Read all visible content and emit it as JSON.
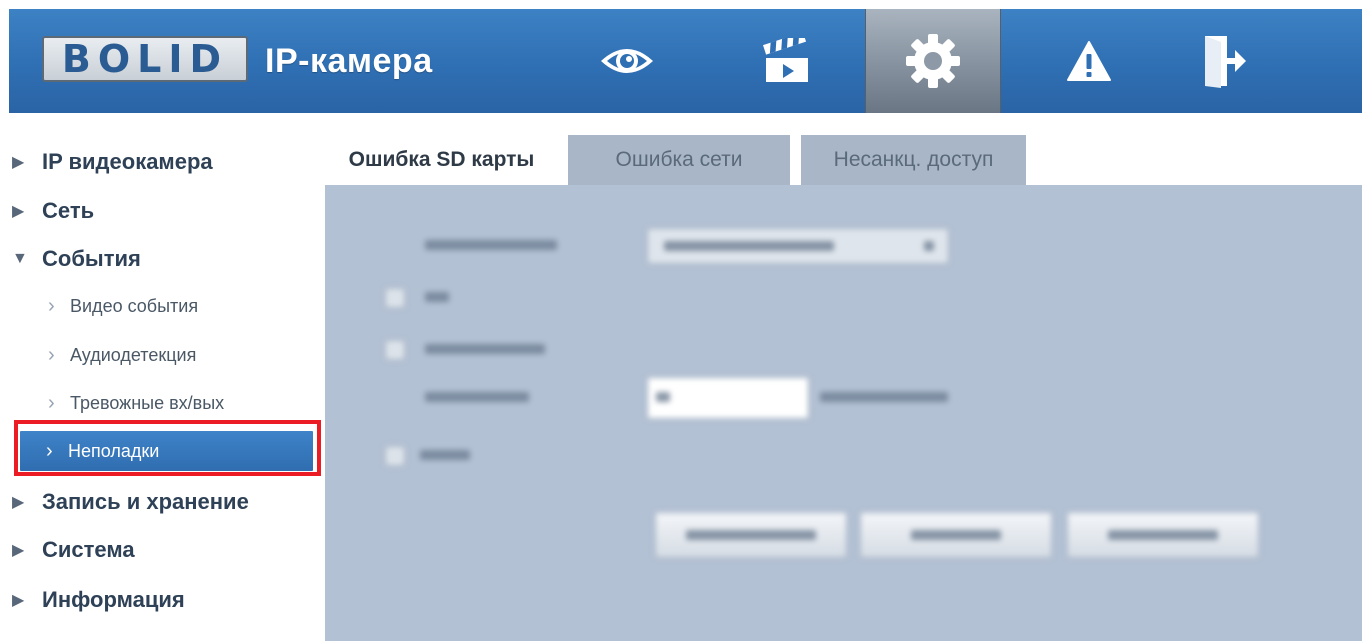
{
  "header": {
    "logo_text": "BOLID",
    "app_title": "IP-камера",
    "nav": [
      {
        "name": "live-view",
        "icon": "eye-icon",
        "active": false
      },
      {
        "name": "playback",
        "icon": "clapperboard-icon",
        "active": false
      },
      {
        "name": "settings",
        "icon": "gear-icon",
        "active": true
      },
      {
        "name": "alarm",
        "icon": "warning-triangle-icon",
        "active": false
      },
      {
        "name": "logout",
        "icon": "logout-door-icon",
        "active": false
      }
    ]
  },
  "sidebar": {
    "items": [
      {
        "label": "IP видеокамера",
        "level": 1,
        "expanded": false
      },
      {
        "label": "Сеть",
        "level": 1,
        "expanded": false
      },
      {
        "label": "События",
        "level": 1,
        "expanded": true
      },
      {
        "label": "Видео события",
        "level": 2
      },
      {
        "label": "Аудиодетекция",
        "level": 2
      },
      {
        "label": "Тревожные вх/вых",
        "level": 2
      },
      {
        "label": "Неполадки",
        "level": 2,
        "selected": true
      },
      {
        "label": "Запись и хранение",
        "level": 1,
        "expanded": false
      },
      {
        "label": "Система",
        "level": 1,
        "expanded": false
      },
      {
        "label": "Информация",
        "level": 1,
        "expanded": false
      }
    ]
  },
  "main": {
    "tabs": [
      {
        "label": "Ошибка SD карты",
        "active": true
      },
      {
        "label": "Ошибка сети",
        "active": false
      },
      {
        "label": "Несанкц. доступ",
        "active": false
      }
    ]
  },
  "colors": {
    "header": "#2f6fb3",
    "panel": "#b3c1d4",
    "highlight": "#ec1c24",
    "selected_item": "#3477bd"
  }
}
